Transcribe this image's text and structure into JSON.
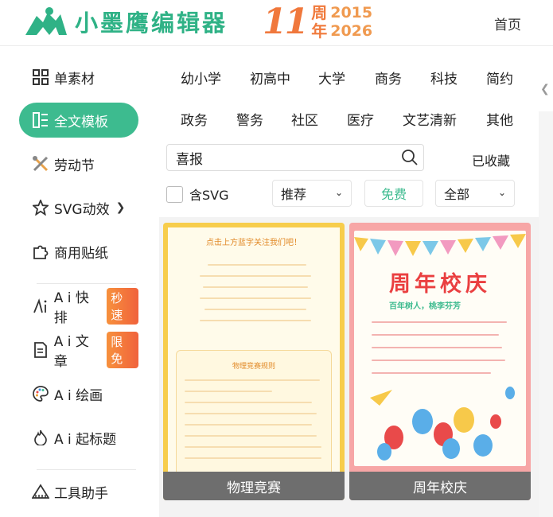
{
  "header": {
    "logo_text": "小墨鹰编辑器",
    "anniv_number": "11",
    "anniv_zhou": "周",
    "anniv_nian": "年",
    "anniv_year_start": "2015",
    "anniv_year_end": "2026",
    "home_label": "首页"
  },
  "sidebar": {
    "items": [
      {
        "label": "单素材",
        "icon": "grid-icon"
      },
      {
        "label": "全文模板",
        "icon": "template-icon",
        "active": true
      },
      {
        "label": "劳动节",
        "icon": "tools-icon"
      },
      {
        "label": "SVG动效",
        "icon": "star-icon"
      },
      {
        "label": "商用贴纸",
        "icon": "puzzle-icon"
      },
      {
        "label": "A i 快排",
        "icon": "ai-icon",
        "badge": "秒速"
      },
      {
        "label": "A i 文章",
        "icon": "doc-icon",
        "badge": "限免"
      },
      {
        "label": "A i 绘画",
        "icon": "palette-icon"
      },
      {
        "label": "A i 起标题",
        "icon": "flame-icon"
      },
      {
        "label": "工具助手",
        "icon": "ruler-icon"
      }
    ]
  },
  "categories": [
    "幼小学",
    "初高中",
    "大学",
    "商务",
    "科技",
    "简约",
    "政务",
    "警务",
    "社区",
    "医疗",
    "文艺清新",
    "其他"
  ],
  "search": {
    "value": "喜报"
  },
  "saved_label": "已收藏",
  "filters": {
    "svg_label": "含SVG",
    "sort_value": "推荐",
    "free_label": "免费",
    "scope_value": "全部"
  },
  "cards": [
    {
      "label": "物理竞赛",
      "title": "点击上方蓝字关注我们吧！",
      "subtitle": "物理竞赛规则",
      "colors": {
        "frame": "#f7cd4c",
        "text": "#e28a28"
      }
    },
    {
      "label": "周年校庆",
      "title": "周年校庆",
      "subtitle": "百年树人，桃李芬芳",
      "colors": {
        "frame": "#f7a6a6",
        "title": "#ea3f40"
      }
    }
  ],
  "colors": {
    "accent": "#3dbb8f",
    "badge": "#f0703c"
  }
}
